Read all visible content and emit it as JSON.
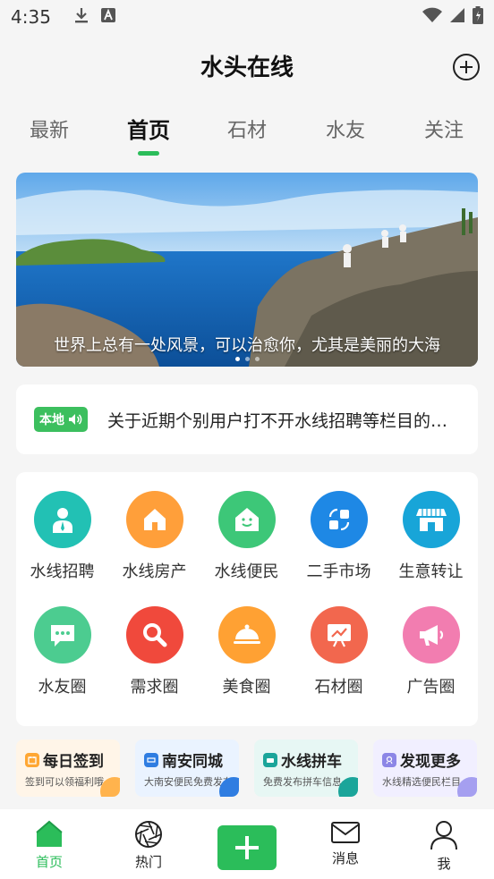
{
  "status": {
    "time": "4:35",
    "left_icons": [
      "download-icon",
      "notification-a-icon"
    ],
    "right_icons": [
      "wifi-icon",
      "signal-icon",
      "battery-icon"
    ]
  },
  "header": {
    "title": "水头在线",
    "add_icon": "plus-circle-icon"
  },
  "tabs": [
    {
      "label": "最新",
      "active": false
    },
    {
      "label": "首页",
      "active": true
    },
    {
      "label": "石材",
      "active": false
    },
    {
      "label": "水友",
      "active": false
    },
    {
      "label": "关注",
      "active": false
    }
  ],
  "banner": {
    "caption": "世界上总有一处风景，可以治愈你，尤其是美丽的大海",
    "dots": 3,
    "active_dot": 0
  },
  "notice": {
    "badge": "本地",
    "text": "关于近期个别用户打不开水线招聘等栏目的问题"
  },
  "grid": [
    {
      "label": "水线招聘",
      "icon": "recruit-person-icon",
      "color": "#22c1b4"
    },
    {
      "label": "水线房产",
      "icon": "house-icon",
      "color": "#ff9f3a"
    },
    {
      "label": "水线便民",
      "icon": "smile-house-icon",
      "color": "#3dc778"
    },
    {
      "label": "二手市场",
      "icon": "exchange-icon",
      "color": "#1e88e5"
    },
    {
      "label": "生意转让",
      "icon": "shop-icon",
      "color": "#18a5d8"
    },
    {
      "label": "水友圈",
      "icon": "chat-bubble-icon",
      "color": "#4ccc90"
    },
    {
      "label": "需求圈",
      "icon": "search-icon",
      "color": "#f0493c"
    },
    {
      "label": "美食圈",
      "icon": "food-dome-icon",
      "color": "#ffa133"
    },
    {
      "label": "石材圈",
      "icon": "board-chart-icon",
      "color": "#f2674e"
    },
    {
      "label": "广告圈",
      "icon": "megaphone-icon",
      "color": "#f27db0"
    }
  ],
  "shortcuts": [
    {
      "title": "每日签到",
      "subtitle": "签到可以领福利哦",
      "icon": "calendar-icon",
      "color": "#ffa733",
      "bg": "#fff5e8"
    },
    {
      "title": "南安同城",
      "subtitle": "大南安便民免费发布",
      "icon": "map-tag-icon",
      "color": "#2f7de1",
      "bg": "#eaf3ff"
    },
    {
      "title": "水线拼车",
      "subtitle": "免费发布拼车信息",
      "icon": "car-icon",
      "color": "#1ba59a",
      "bg": "#e7f7f4"
    },
    {
      "title": "发现更多",
      "subtitle": "水线精选便民栏目",
      "icon": "discover-icon",
      "color": "#8c86e6",
      "bg": "#f1efff"
    }
  ],
  "tabbar": [
    {
      "label": "首页",
      "icon": "home-icon",
      "active": true
    },
    {
      "label": "热门",
      "icon": "aperture-icon",
      "active": false
    },
    {
      "label": "",
      "icon": "plus-icon",
      "active": false
    },
    {
      "label": "消息",
      "icon": "mail-icon",
      "active": false
    },
    {
      "label": "我",
      "icon": "user-icon",
      "active": false
    }
  ],
  "colors": {
    "accent": "#2bbd5a",
    "background": "#f5f5f5"
  }
}
